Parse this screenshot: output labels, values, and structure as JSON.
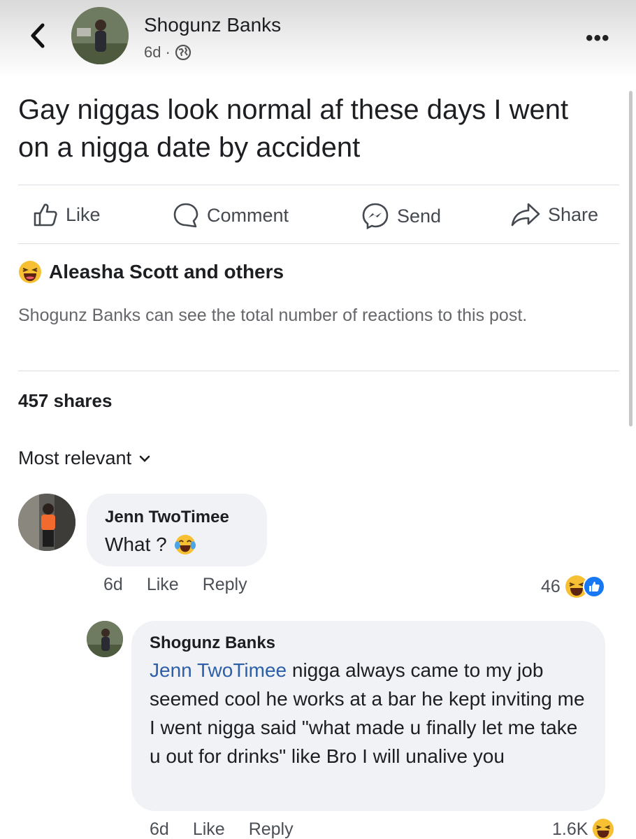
{
  "post": {
    "author": "Shogunz Banks",
    "time": "6d",
    "separator": "·",
    "text": "Gay niggas look normal af these days I went on a nigga date by accident"
  },
  "actions": {
    "like": "Like",
    "comment": "Comment",
    "send": "Send",
    "share": "Share"
  },
  "reactions": {
    "summary": "Aleasha Scott and others",
    "note": "Shogunz Banks can see the total number of reactions to this post."
  },
  "shares": "457 shares",
  "sort": {
    "label": "Most relevant"
  },
  "comments": [
    {
      "name": "Jenn TwoTimee",
      "text": "What ?",
      "time": "6d",
      "like": "Like",
      "reply": "Reply",
      "count": "46"
    },
    {
      "name": "Shogunz Banks",
      "mention": "Jenn TwoTimee",
      "text": " nigga always came to my job seemed cool he works at a bar he kept inviting me I went nigga said \"what made u finally let me take u out for drinks\" like Bro I will unalive you",
      "time": "6d",
      "like": "Like",
      "reply": "Reply",
      "count": "1.6K"
    }
  ],
  "colors": {
    "mention": "#2d5ea8",
    "secondary_text": "#65676b",
    "bubble": "#f0f2f5",
    "like_blue": "#1877f2"
  }
}
